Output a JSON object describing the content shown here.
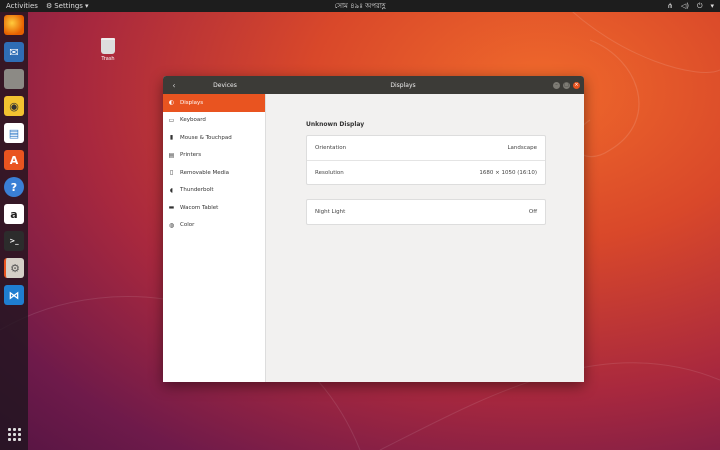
{
  "topbar": {
    "activities": "Activities",
    "app_menu": "Settings",
    "clock": "সোম ৪৯ঃ অপরাহ্ণ"
  },
  "desktop": {
    "trash_label": "Trash"
  },
  "dock": {
    "items": [
      {
        "name": "firefox-icon",
        "color": "#e66000"
      },
      {
        "name": "thunderbird-icon",
        "color": "#2f6db5"
      },
      {
        "name": "files-icon",
        "color": "#8c8a85"
      },
      {
        "name": "rhythmbox-icon",
        "color": "#f2c230"
      },
      {
        "name": "libreoffice-writer-icon",
        "color": "#2a76c6"
      },
      {
        "name": "software-center-icon",
        "color": "#e95420"
      },
      {
        "name": "help-icon",
        "color": "#3a7fd5"
      },
      {
        "name": "amazon-icon",
        "color": "#ffffff"
      },
      {
        "name": "terminal-icon",
        "color": "#2c2c2c"
      },
      {
        "name": "settings-icon",
        "color": "#d5d0c8"
      },
      {
        "name": "vscode-icon",
        "color": "#1f7ed1"
      }
    ]
  },
  "window": {
    "left_title": "Devices",
    "title": "Displays"
  },
  "sidebar": {
    "items": [
      {
        "label": "Displays",
        "icon": "display-icon"
      },
      {
        "label": "Keyboard",
        "icon": "keyboard-icon"
      },
      {
        "label": "Mouse & Touchpad",
        "icon": "mouse-icon"
      },
      {
        "label": "Printers",
        "icon": "printer-icon"
      },
      {
        "label": "Removable Media",
        "icon": "media-icon"
      },
      {
        "label": "Thunderbolt",
        "icon": "thunderbolt-icon"
      },
      {
        "label": "Wacom Tablet",
        "icon": "tablet-icon"
      },
      {
        "label": "Color",
        "icon": "color-icon"
      }
    ],
    "active_index": 0
  },
  "display": {
    "section_title": "Unknown Display",
    "orientation_label": "Orientation",
    "orientation_value": "Landscape",
    "resolution_label": "Resolution",
    "resolution_value": "1680 × 1050 (16∶10)",
    "night_light_label": "Night Light",
    "night_light_value": "Off"
  },
  "colors": {
    "accent": "#e95420",
    "titlebar": "#3c3b37"
  }
}
